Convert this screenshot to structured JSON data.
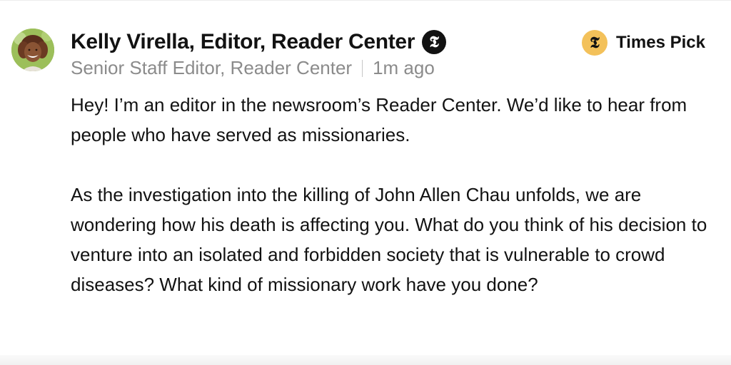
{
  "comment": {
    "author": {
      "name": "Kelly Virella, Editor, Reader Center",
      "title": "Senior Staff Editor, Reader Center",
      "timestamp": "1m ago",
      "badge_glyph": "𝕿",
      "badge_icon": "nyt-logo-icon"
    },
    "times_pick": {
      "label": "Times Pick",
      "badge_glyph": "𝕿",
      "badge_icon": "nyt-logo-icon",
      "color": "#f3c15a"
    },
    "paragraphs": [
      "Hey! I’m an editor in the newsroom’s Reader Center. We’d like to hear from people who have served as missionaries.",
      "As the investigation into the killing of John Allen Chau unfolds, we are wondering how his death is affecting you. What do you think of his decision to venture into an isolated and forbidden society that is vulnerable to crowd diseases? What kind of missionary work have you done?"
    ]
  },
  "colors": {
    "text": "#121212",
    "meta": "#8b8b8b",
    "badge_dark": "#121212",
    "pick_gold": "#f3c15a"
  }
}
